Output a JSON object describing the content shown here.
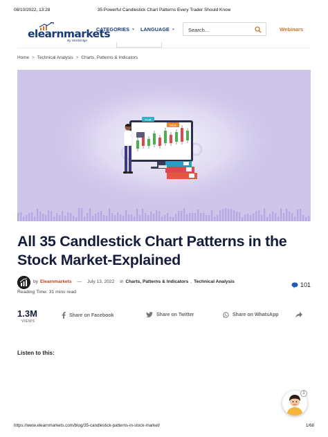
{
  "print_header": {
    "date": "08/10/2022, 13:28",
    "title": "35 Powerful Candlestick Chart Patterns Every Trader Should Know"
  },
  "header": {
    "logo_text": "elearnmarkets",
    "logo_subtext": "By StockEdge",
    "nav": {
      "categories": "CATEGORIES",
      "language": "LANGUAGE"
    },
    "search_placeholder": "Search...",
    "webinars": "Webinars",
    "colors": {
      "brand": "#173b7a",
      "accent": "#c8742a"
    }
  },
  "breadcrumb": [
    "Home",
    "Technical Analysis",
    "Charts, Patterns & Indicators"
  ],
  "breadcrumb_sep": ">",
  "hero": {
    "background": "#cdc5ea",
    "screen_tags": [
      "Profit",
      "Stock"
    ]
  },
  "article": {
    "title": "All 35 Candlestick Chart Patterns in the Stock Market-Explained",
    "by": "by",
    "author": "Elearnmarkets",
    "dash": "—",
    "date": "July 13, 2022",
    "in": "in",
    "category_1": "Charts, Patterns & Indicators",
    "category_2": "Technical Analysis",
    "comma": ",",
    "reading_time": "Reading Time: 31 mins read",
    "comments": "101"
  },
  "share": {
    "views": "1.3M",
    "views_label": "VIEWS",
    "facebook": "Share on Facebook",
    "twitter": "Share on Twitter",
    "whatsapp": "Share on WhatsApp"
  },
  "listen": "Listen to this:",
  "chat_badge": "1",
  "footer": {
    "url": "https://www.elearnmarkets.com/blog/35-candlestick-patterns-in-stock-market/",
    "page": "1/68"
  }
}
